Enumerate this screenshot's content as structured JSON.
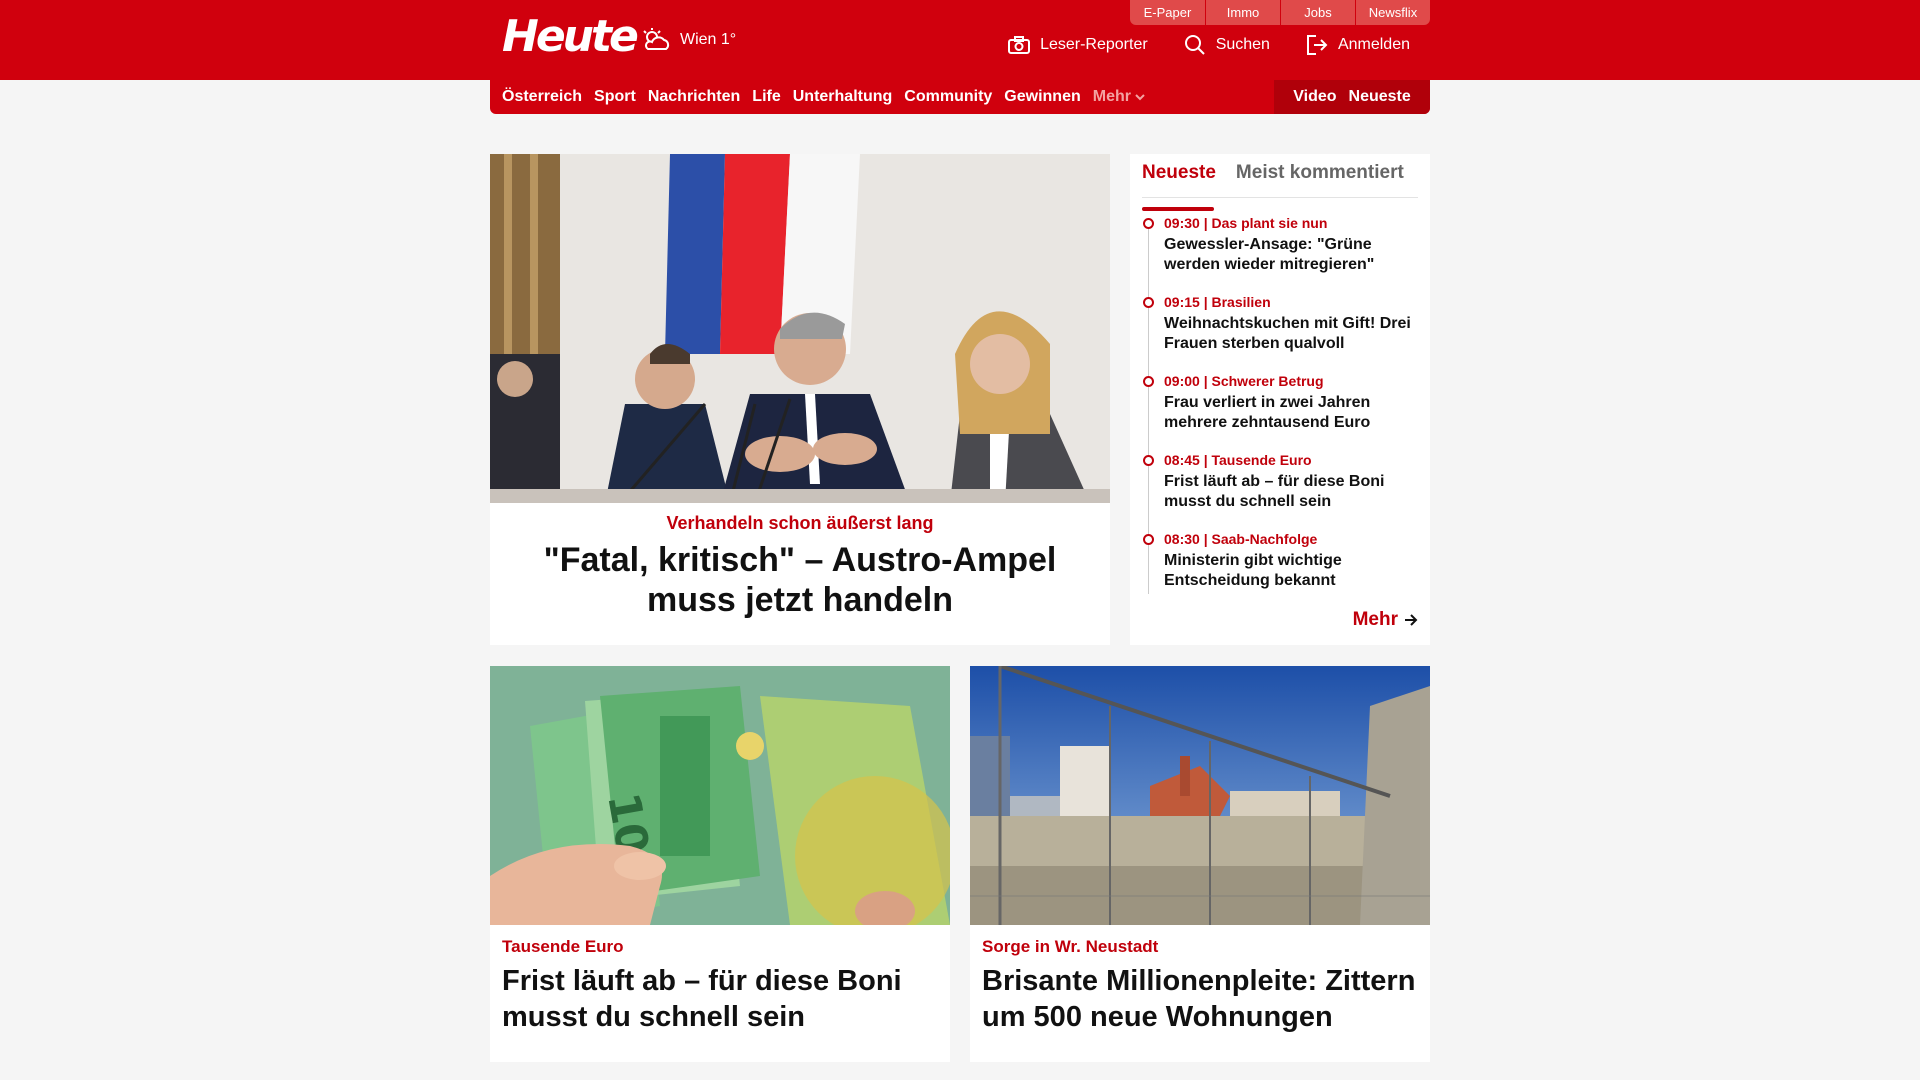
{
  "header": {
    "logo": "Heute",
    "weather": "Wien 1°",
    "service_tabs": [
      "E-Paper",
      "Immo",
      "Jobs",
      "Newsflix"
    ],
    "tools": {
      "reporter": "Leser-Reporter",
      "search": "Suchen",
      "login": "Anmelden"
    }
  },
  "nav": {
    "items": [
      "Österreich",
      "Sport",
      "Nachrichten",
      "Life",
      "Unterhaltung",
      "Community",
      "Gewinnen"
    ],
    "more": "Mehr",
    "right": [
      "Video",
      "Neueste"
    ]
  },
  "lead": {
    "kicker": "Verhandeln schon äußerst lang",
    "title": "\"Fatal, kritisch\" – Austro-Ampel muss jetzt handeln"
  },
  "ticker": {
    "tabs": [
      "Neueste",
      "Meist kommentiert"
    ],
    "items": [
      {
        "meta": "09:30 | Das plant sie nun",
        "title": "Gewessler-Ansage: \"Grüne werden wieder mitregieren\""
      },
      {
        "meta": "09:15 | Brasilien",
        "title": "Weihnachtskuchen mit Gift! Drei Frauen sterben qualvoll"
      },
      {
        "meta": "09:00 | Schwerer Betrug",
        "title": "Frau verliert in zwei Jahren mehrere zehntausend Euro"
      },
      {
        "meta": "08:45 | Tausende Euro",
        "title": "Frist läuft ab – für diese Boni musst du schnell sein"
      },
      {
        "meta": "08:30 | Saab-Nachfolge",
        "title": "Ministerin gibt wichtige Entscheidung bekannt"
      }
    ],
    "more": "Mehr"
  },
  "cards": [
    {
      "kicker": "Tausende Euro",
      "title": "Frist läuft ab – für diese Boni musst du schnell sein"
    },
    {
      "kicker": "Sorge in Wr. Neustadt",
      "title": "Brisante Millionenpleite: Zittern um 500 neue Wohnungen"
    }
  ],
  "colors": {
    "brand": "#d0000d",
    "accent": "#c0000b",
    "background": "#f5f5f5"
  }
}
